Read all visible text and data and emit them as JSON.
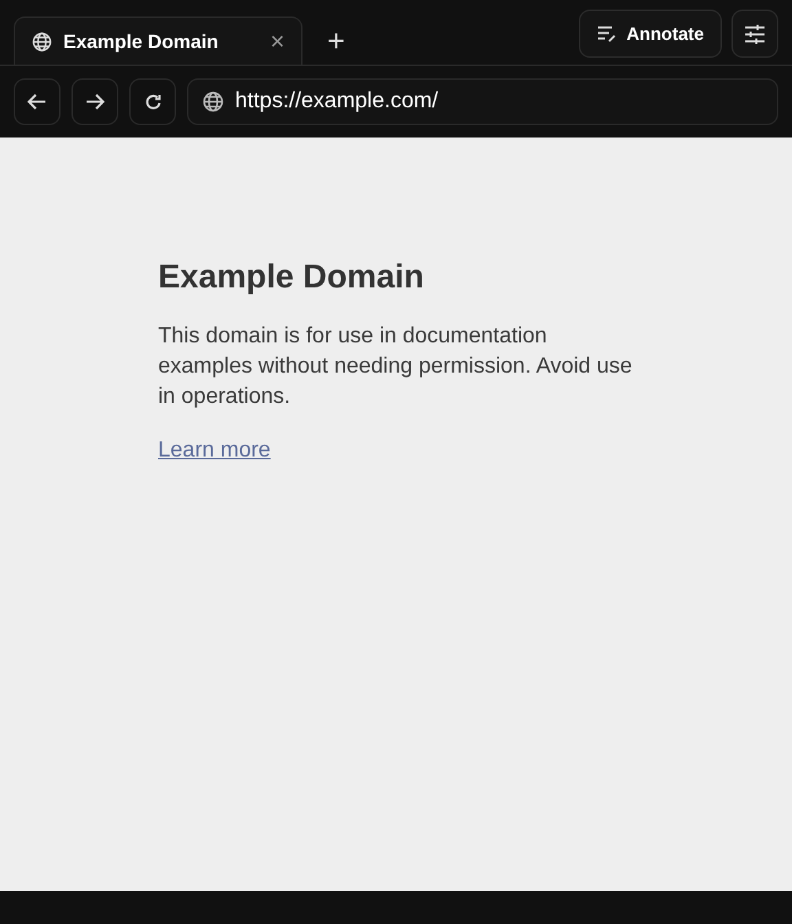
{
  "tabs": [
    {
      "title": "Example Domain",
      "close": "×",
      "selected": true
    }
  ],
  "new_tab": "+",
  "toolbar": {
    "annotate": "Annotate"
  },
  "address_bar": {
    "url": "https://example.com/"
  },
  "page": {
    "heading": "Example Domain",
    "paragraph": "This domain is for use in documentation examples without needing permission. Avoid use in operations.",
    "link": "Learn more"
  }
}
